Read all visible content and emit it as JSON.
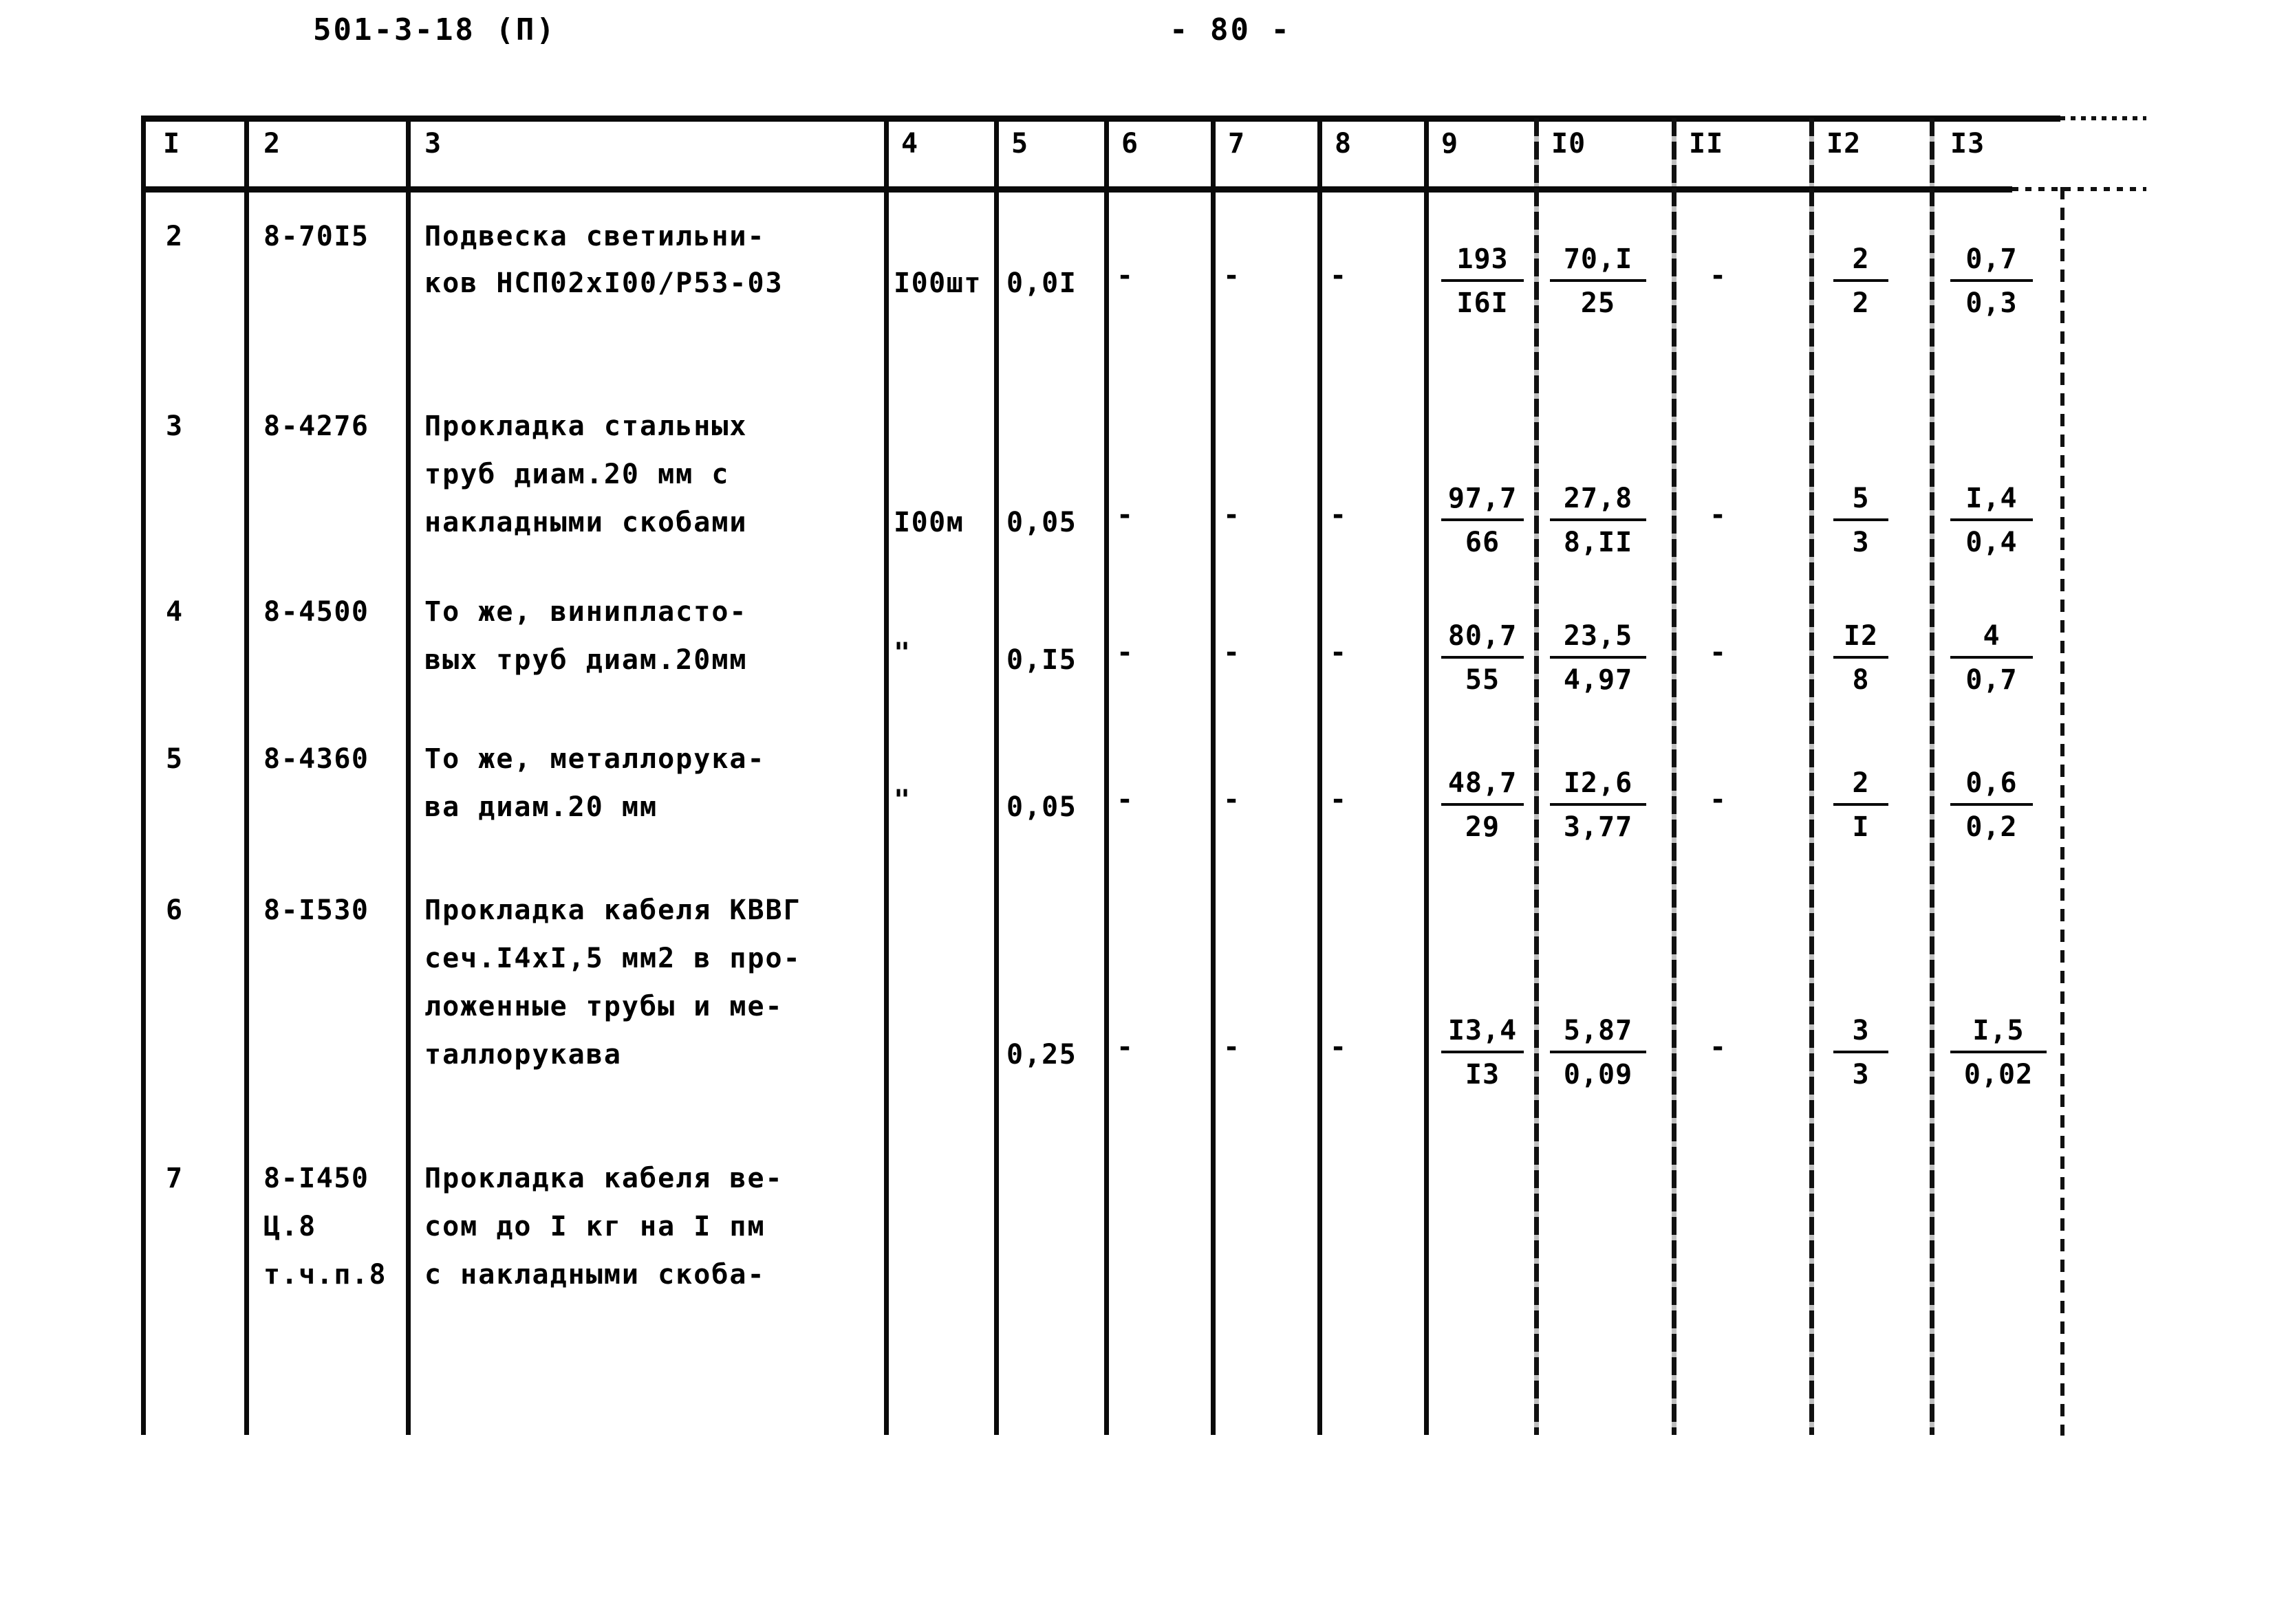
{
  "header": {
    "doc_code": "501-3-18 (П)",
    "page_number": "- 80 -"
  },
  "table": {
    "column_headers": [
      "I",
      "2",
      "3",
      "4",
      "5",
      "6",
      "7",
      "8",
      "9",
      "I0",
      "II",
      "I2",
      "I3"
    ],
    "rows": [
      {
        "no": "2",
        "code": "8-70I5",
        "code_extra": [],
        "desc": [
          "Подвеска светильни-",
          "ков НСП02хI00/Р53-03"
        ],
        "unit": "I00шт",
        "qty": "0,0I",
        "c6": "-",
        "c7": "-",
        "c8": "-",
        "c9": {
          "num": "193",
          "den": "I6I"
        },
        "c10": {
          "num": "70,I",
          "den": "25"
        },
        "c11": "-",
        "c12": {
          "num": "2",
          "den": "2"
        },
        "c13": {
          "num": "0,7",
          "den": "0,3"
        }
      },
      {
        "no": "3",
        "code": "8-4276",
        "code_extra": [],
        "desc": [
          "Прокладка стальных",
          "труб диам.20 мм с",
          "накладными скобами"
        ],
        "unit": "I00м",
        "qty": "0,05",
        "c6": "-",
        "c7": "-",
        "c8": "-",
        "c9": {
          "num": "97,7",
          "den": "66"
        },
        "c10": {
          "num": "27,8",
          "den": "8,II"
        },
        "c11": "-",
        "c12": {
          "num": "5",
          "den": "3"
        },
        "c13": {
          "num": "I,4",
          "den": "0,4"
        }
      },
      {
        "no": "4",
        "code": "8-4500",
        "code_extra": [],
        "desc": [
          "То же, винипласто-",
          "вых труб диам.20мм"
        ],
        "unit": "\"",
        "qty": "0,I5",
        "c6": "-",
        "c7": "-",
        "c8": "-",
        "c9": {
          "num": "80,7",
          "den": "55"
        },
        "c10": {
          "num": "23,5",
          "den": "4,97"
        },
        "c11": "-",
        "c12": {
          "num": "I2",
          "den": "8"
        },
        "c13": {
          "num": "4",
          "den": "0,7"
        }
      },
      {
        "no": "5",
        "code": "8-4360",
        "code_extra": [],
        "desc": [
          "То же, металлорука-",
          "ва диам.20 мм"
        ],
        "unit": "\"",
        "qty": "0,05",
        "c6": "-",
        "c7": "-",
        "c8": "-",
        "c9": {
          "num": "48,7",
          "den": "29"
        },
        "c10": {
          "num": "I2,6",
          "den": "3,77"
        },
        "c11": "-",
        "c12": {
          "num": "2",
          "den": "I"
        },
        "c13": {
          "num": "0,6",
          "den": "0,2"
        }
      },
      {
        "no": "6",
        "code": "8-I530",
        "code_extra": [],
        "desc": [
          "Прокладка кабеля КВВГ",
          "сеч.I4хI,5 мм2 в про-",
          "ложенные трубы и ме-",
          "таллорукава"
        ],
        "unit": "",
        "qty": "0,25",
        "c6": "-",
        "c7": "-",
        "c8": "-",
        "c9": {
          "num": "I3,4",
          "den": "I3"
        },
        "c10": {
          "num": "5,87",
          "den": "0,09"
        },
        "c11": "-",
        "c12": {
          "num": "3",
          "den": "3"
        },
        "c13": {
          "num": "I,5",
          "den": "0,02"
        }
      },
      {
        "no": "7",
        "code": "8-I450",
        "code_extra": [
          "Ц.8",
          "т.ч.п.8"
        ],
        "desc": [
          "Прокладка кабеля ве-",
          "сом до I кг на I пм",
          "с накладными скоба-"
        ],
        "unit": "",
        "qty": "",
        "c6": "",
        "c7": "",
        "c8": "",
        "c9": {
          "num": "",
          "den": ""
        },
        "c10": {
          "num": "",
          "den": ""
        },
        "c11": "",
        "c12": {
          "num": "",
          "den": ""
        },
        "c13": {
          "num": "",
          "den": ""
        }
      }
    ]
  }
}
